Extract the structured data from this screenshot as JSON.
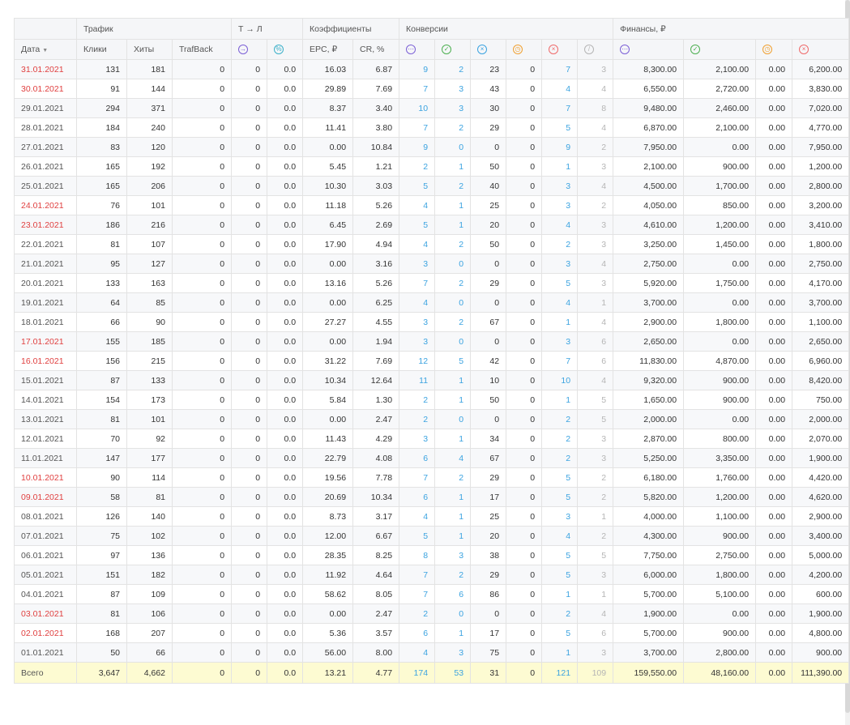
{
  "header": {
    "groups": {
      "traffic": "Трафик",
      "tl": "Т → Л",
      "coefficients": "Коэффициенты",
      "conversions": "Конверсии",
      "finance": "Финансы, ₽"
    },
    "columns": {
      "date": "Дата",
      "clicks": "Клики",
      "hits": "Хиты",
      "trafback": "TrafBack",
      "epc": "EPC, ₽",
      "cr": "CR, %"
    },
    "icons": {
      "tl_count": "arrow-right-circle-icon",
      "tl_percent": "percent-circle-icon",
      "conv_total": "dots-circle-icon",
      "conv_approved": "check-circle-icon",
      "conv_rejected_pct": "x-circle-icon",
      "conv_hold": "clock-circle-icon",
      "conv_rejected": "x-circle-icon",
      "conv_trash": "slash-circle-icon",
      "fin_total": "dots-circle-icon",
      "fin_approved": "check-circle-icon",
      "fin_hold": "clock-circle-icon",
      "fin_rejected": "x-circle-icon"
    }
  },
  "rows": [
    {
      "date": "31.01.2021",
      "weekend": true,
      "clicks": "131",
      "hits": "181",
      "trafback": "0",
      "tl": "0",
      "tlp": "0.0",
      "epc": "16.03",
      "cr": "6.87",
      "ct": "9",
      "ca": "2",
      "cp": "23",
      "ch": "0",
      "cr2": "7",
      "cx": "3",
      "ft": "8,300.00",
      "fa": "2,100.00",
      "fh": "0.00",
      "fr": "6,200.00"
    },
    {
      "date": "30.01.2021",
      "weekend": true,
      "clicks": "91",
      "hits": "144",
      "trafback": "0",
      "tl": "0",
      "tlp": "0.0",
      "epc": "29.89",
      "cr": "7.69",
      "ct": "7",
      "ca": "3",
      "cp": "43",
      "ch": "0",
      "cr2": "4",
      "cx": "4",
      "ft": "6,550.00",
      "fa": "2,720.00",
      "fh": "0.00",
      "fr": "3,830.00"
    },
    {
      "date": "29.01.2021",
      "weekend": false,
      "clicks": "294",
      "hits": "371",
      "trafback": "0",
      "tl": "0",
      "tlp": "0.0",
      "epc": "8.37",
      "cr": "3.40",
      "ct": "10",
      "ca": "3",
      "cp": "30",
      "ch": "0",
      "cr2": "7",
      "cx": "8",
      "ft": "9,480.00",
      "fa": "2,460.00",
      "fh": "0.00",
      "fr": "7,020.00"
    },
    {
      "date": "28.01.2021",
      "weekend": false,
      "clicks": "184",
      "hits": "240",
      "trafback": "0",
      "tl": "0",
      "tlp": "0.0",
      "epc": "11.41",
      "cr": "3.80",
      "ct": "7",
      "ca": "2",
      "cp": "29",
      "ch": "0",
      "cr2": "5",
      "cx": "4",
      "ft": "6,870.00",
      "fa": "2,100.00",
      "fh": "0.00",
      "fr": "4,770.00"
    },
    {
      "date": "27.01.2021",
      "weekend": false,
      "clicks": "83",
      "hits": "120",
      "trafback": "0",
      "tl": "0",
      "tlp": "0.0",
      "epc": "0.00",
      "cr": "10.84",
      "ct": "9",
      "ca": "0",
      "cp": "0",
      "ch": "0",
      "cr2": "9",
      "cx": "2",
      "ft": "7,950.00",
      "fa": "0.00",
      "fh": "0.00",
      "fr": "7,950.00"
    },
    {
      "date": "26.01.2021",
      "weekend": false,
      "clicks": "165",
      "hits": "192",
      "trafback": "0",
      "tl": "0",
      "tlp": "0.0",
      "epc": "5.45",
      "cr": "1.21",
      "ct": "2",
      "ca": "1",
      "cp": "50",
      "ch": "0",
      "cr2": "1",
      "cx": "3",
      "ft": "2,100.00",
      "fa": "900.00",
      "fh": "0.00",
      "fr": "1,200.00"
    },
    {
      "date": "25.01.2021",
      "weekend": false,
      "clicks": "165",
      "hits": "206",
      "trafback": "0",
      "tl": "0",
      "tlp": "0.0",
      "epc": "10.30",
      "cr": "3.03",
      "ct": "5",
      "ca": "2",
      "cp": "40",
      "ch": "0",
      "cr2": "3",
      "cx": "4",
      "ft": "4,500.00",
      "fa": "1,700.00",
      "fh": "0.00",
      "fr": "2,800.00"
    },
    {
      "date": "24.01.2021",
      "weekend": true,
      "clicks": "76",
      "hits": "101",
      "trafback": "0",
      "tl": "0",
      "tlp": "0.0",
      "epc": "11.18",
      "cr": "5.26",
      "ct": "4",
      "ca": "1",
      "cp": "25",
      "ch": "0",
      "cr2": "3",
      "cx": "2",
      "ft": "4,050.00",
      "fa": "850.00",
      "fh": "0.00",
      "fr": "3,200.00"
    },
    {
      "date": "23.01.2021",
      "weekend": true,
      "clicks": "186",
      "hits": "216",
      "trafback": "0",
      "tl": "0",
      "tlp": "0.0",
      "epc": "6.45",
      "cr": "2.69",
      "ct": "5",
      "ca": "1",
      "cp": "20",
      "ch": "0",
      "cr2": "4",
      "cx": "3",
      "ft": "4,610.00",
      "fa": "1,200.00",
      "fh": "0.00",
      "fr": "3,410.00"
    },
    {
      "date": "22.01.2021",
      "weekend": false,
      "clicks": "81",
      "hits": "107",
      "trafback": "0",
      "tl": "0",
      "tlp": "0.0",
      "epc": "17.90",
      "cr": "4.94",
      "ct": "4",
      "ca": "2",
      "cp": "50",
      "ch": "0",
      "cr2": "2",
      "cx": "3",
      "ft": "3,250.00",
      "fa": "1,450.00",
      "fh": "0.00",
      "fr": "1,800.00"
    },
    {
      "date": "21.01.2021",
      "weekend": false,
      "clicks": "95",
      "hits": "127",
      "trafback": "0",
      "tl": "0",
      "tlp": "0.0",
      "epc": "0.00",
      "cr": "3.16",
      "ct": "3",
      "ca": "0",
      "cp": "0",
      "ch": "0",
      "cr2": "3",
      "cx": "4",
      "ft": "2,750.00",
      "fa": "0.00",
      "fh": "0.00",
      "fr": "2,750.00"
    },
    {
      "date": "20.01.2021",
      "weekend": false,
      "clicks": "133",
      "hits": "163",
      "trafback": "0",
      "tl": "0",
      "tlp": "0.0",
      "epc": "13.16",
      "cr": "5.26",
      "ct": "7",
      "ca": "2",
      "cp": "29",
      "ch": "0",
      "cr2": "5",
      "cx": "3",
      "ft": "5,920.00",
      "fa": "1,750.00",
      "fh": "0.00",
      "fr": "4,170.00"
    },
    {
      "date": "19.01.2021",
      "weekend": false,
      "clicks": "64",
      "hits": "85",
      "trafback": "0",
      "tl": "0",
      "tlp": "0.0",
      "epc": "0.00",
      "cr": "6.25",
      "ct": "4",
      "ca": "0",
      "cp": "0",
      "ch": "0",
      "cr2": "4",
      "cx": "1",
      "ft": "3,700.00",
      "fa": "0.00",
      "fh": "0.00",
      "fr": "3,700.00"
    },
    {
      "date": "18.01.2021",
      "weekend": false,
      "clicks": "66",
      "hits": "90",
      "trafback": "0",
      "tl": "0",
      "tlp": "0.0",
      "epc": "27.27",
      "cr": "4.55",
      "ct": "3",
      "ca": "2",
      "cp": "67",
      "ch": "0",
      "cr2": "1",
      "cx": "4",
      "ft": "2,900.00",
      "fa": "1,800.00",
      "fh": "0.00",
      "fr": "1,100.00"
    },
    {
      "date": "17.01.2021",
      "weekend": true,
      "clicks": "155",
      "hits": "185",
      "trafback": "0",
      "tl": "0",
      "tlp": "0.0",
      "epc": "0.00",
      "cr": "1.94",
      "ct": "3",
      "ca": "0",
      "cp": "0",
      "ch": "0",
      "cr2": "3",
      "cx": "6",
      "ft": "2,650.00",
      "fa": "0.00",
      "fh": "0.00",
      "fr": "2,650.00"
    },
    {
      "date": "16.01.2021",
      "weekend": true,
      "clicks": "156",
      "hits": "215",
      "trafback": "0",
      "tl": "0",
      "tlp": "0.0",
      "epc": "31.22",
      "cr": "7.69",
      "ct": "12",
      "ca": "5",
      "cp": "42",
      "ch": "0",
      "cr2": "7",
      "cx": "6",
      "ft": "11,830.00",
      "fa": "4,870.00",
      "fh": "0.00",
      "fr": "6,960.00"
    },
    {
      "date": "15.01.2021",
      "weekend": false,
      "clicks": "87",
      "hits": "133",
      "trafback": "0",
      "tl": "0",
      "tlp": "0.0",
      "epc": "10.34",
      "cr": "12.64",
      "ct": "11",
      "ca": "1",
      "cp": "10",
      "ch": "0",
      "cr2": "10",
      "cx": "4",
      "ft": "9,320.00",
      "fa": "900.00",
      "fh": "0.00",
      "fr": "8,420.00"
    },
    {
      "date": "14.01.2021",
      "weekend": false,
      "clicks": "154",
      "hits": "173",
      "trafback": "0",
      "tl": "0",
      "tlp": "0.0",
      "epc": "5.84",
      "cr": "1.30",
      "ct": "2",
      "ca": "1",
      "cp": "50",
      "ch": "0",
      "cr2": "1",
      "cx": "5",
      "ft": "1,650.00",
      "fa": "900.00",
      "fh": "0.00",
      "fr": "750.00"
    },
    {
      "date": "13.01.2021",
      "weekend": false,
      "clicks": "81",
      "hits": "101",
      "trafback": "0",
      "tl": "0",
      "tlp": "0.0",
      "epc": "0.00",
      "cr": "2.47",
      "ct": "2",
      "ca": "0",
      "cp": "0",
      "ch": "0",
      "cr2": "2",
      "cx": "5",
      "ft": "2,000.00",
      "fa": "0.00",
      "fh": "0.00",
      "fr": "2,000.00"
    },
    {
      "date": "12.01.2021",
      "weekend": false,
      "clicks": "70",
      "hits": "92",
      "trafback": "0",
      "tl": "0",
      "tlp": "0.0",
      "epc": "11.43",
      "cr": "4.29",
      "ct": "3",
      "ca": "1",
      "cp": "34",
      "ch": "0",
      "cr2": "2",
      "cx": "3",
      "ft": "2,870.00",
      "fa": "800.00",
      "fh": "0.00",
      "fr": "2,070.00"
    },
    {
      "date": "11.01.2021",
      "weekend": false,
      "clicks": "147",
      "hits": "177",
      "trafback": "0",
      "tl": "0",
      "tlp": "0.0",
      "epc": "22.79",
      "cr": "4.08",
      "ct": "6",
      "ca": "4",
      "cp": "67",
      "ch": "0",
      "cr2": "2",
      "cx": "3",
      "ft": "5,250.00",
      "fa": "3,350.00",
      "fh": "0.00",
      "fr": "1,900.00"
    },
    {
      "date": "10.01.2021",
      "weekend": true,
      "clicks": "90",
      "hits": "114",
      "trafback": "0",
      "tl": "0",
      "tlp": "0.0",
      "epc": "19.56",
      "cr": "7.78",
      "ct": "7",
      "ca": "2",
      "cp": "29",
      "ch": "0",
      "cr2": "5",
      "cx": "2",
      "ft": "6,180.00",
      "fa": "1,760.00",
      "fh": "0.00",
      "fr": "4,420.00"
    },
    {
      "date": "09.01.2021",
      "weekend": true,
      "clicks": "58",
      "hits": "81",
      "trafback": "0",
      "tl": "0",
      "tlp": "0.0",
      "epc": "20.69",
      "cr": "10.34",
      "ct": "6",
      "ca": "1",
      "cp": "17",
      "ch": "0",
      "cr2": "5",
      "cx": "2",
      "ft": "5,820.00",
      "fa": "1,200.00",
      "fh": "0.00",
      "fr": "4,620.00"
    },
    {
      "date": "08.01.2021",
      "weekend": false,
      "clicks": "126",
      "hits": "140",
      "trafback": "0",
      "tl": "0",
      "tlp": "0.0",
      "epc": "8.73",
      "cr": "3.17",
      "ct": "4",
      "ca": "1",
      "cp": "25",
      "ch": "0",
      "cr2": "3",
      "cx": "1",
      "ft": "4,000.00",
      "fa": "1,100.00",
      "fh": "0.00",
      "fr": "2,900.00"
    },
    {
      "date": "07.01.2021",
      "weekend": false,
      "clicks": "75",
      "hits": "102",
      "trafback": "0",
      "tl": "0",
      "tlp": "0.0",
      "epc": "12.00",
      "cr": "6.67",
      "ct": "5",
      "ca": "1",
      "cp": "20",
      "ch": "0",
      "cr2": "4",
      "cx": "2",
      "ft": "4,300.00",
      "fa": "900.00",
      "fh": "0.00",
      "fr": "3,400.00"
    },
    {
      "date": "06.01.2021",
      "weekend": false,
      "clicks": "97",
      "hits": "136",
      "trafback": "0",
      "tl": "0",
      "tlp": "0.0",
      "epc": "28.35",
      "cr": "8.25",
      "ct": "8",
      "ca": "3",
      "cp": "38",
      "ch": "0",
      "cr2": "5",
      "cx": "5",
      "ft": "7,750.00",
      "fa": "2,750.00",
      "fh": "0.00",
      "fr": "5,000.00"
    },
    {
      "date": "05.01.2021",
      "weekend": false,
      "clicks": "151",
      "hits": "182",
      "trafback": "0",
      "tl": "0",
      "tlp": "0.0",
      "epc": "11.92",
      "cr": "4.64",
      "ct": "7",
      "ca": "2",
      "cp": "29",
      "ch": "0",
      "cr2": "5",
      "cx": "3",
      "ft": "6,000.00",
      "fa": "1,800.00",
      "fh": "0.00",
      "fr": "4,200.00"
    },
    {
      "date": "04.01.2021",
      "weekend": false,
      "clicks": "87",
      "hits": "109",
      "trafback": "0",
      "tl": "0",
      "tlp": "0.0",
      "epc": "58.62",
      "cr": "8.05",
      "ct": "7",
      "ca": "6",
      "cp": "86",
      "ch": "0",
      "cr2": "1",
      "cx": "1",
      "ft": "5,700.00",
      "fa": "5,100.00",
      "fh": "0.00",
      "fr": "600.00"
    },
    {
      "date": "03.01.2021",
      "weekend": true,
      "clicks": "81",
      "hits": "106",
      "trafback": "0",
      "tl": "0",
      "tlp": "0.0",
      "epc": "0.00",
      "cr": "2.47",
      "ct": "2",
      "ca": "0",
      "cp": "0",
      "ch": "0",
      "cr2": "2",
      "cx": "4",
      "ft": "1,900.00",
      "fa": "0.00",
      "fh": "0.00",
      "fr": "1,900.00"
    },
    {
      "date": "02.01.2021",
      "weekend": true,
      "clicks": "168",
      "hits": "207",
      "trafback": "0",
      "tl": "0",
      "tlp": "0.0",
      "epc": "5.36",
      "cr": "3.57",
      "ct": "6",
      "ca": "1",
      "cp": "17",
      "ch": "0",
      "cr2": "5",
      "cx": "6",
      "ft": "5,700.00",
      "fa": "900.00",
      "fh": "0.00",
      "fr": "4,800.00"
    },
    {
      "date": "01.01.2021",
      "weekend": false,
      "clicks": "50",
      "hits": "66",
      "trafback": "0",
      "tl": "0",
      "tlp": "0.0",
      "epc": "56.00",
      "cr": "8.00",
      "ct": "4",
      "ca": "3",
      "cp": "75",
      "ch": "0",
      "cr2": "1",
      "cx": "3",
      "ft": "3,700.00",
      "fa": "2,800.00",
      "fh": "0.00",
      "fr": "900.00"
    }
  ],
  "total": {
    "label": "Всего",
    "clicks": "3,647",
    "hits": "4,662",
    "trafback": "0",
    "tl": "0",
    "tlp": "0.0",
    "epc": "13.21",
    "cr": "4.77",
    "ct": "174",
    "ca": "53",
    "cp": "31",
    "ch": "0",
    "cr2": "121",
    "cx": "109",
    "ft": "159,550.00",
    "fa": "48,160.00",
    "fh": "0.00",
    "fr": "111,390.00"
  },
  "colors": {
    "weekend": "#e04040",
    "link": "#3ba3e0",
    "muted": "#b5b5b5",
    "total_bg": "#fdfbd2"
  }
}
